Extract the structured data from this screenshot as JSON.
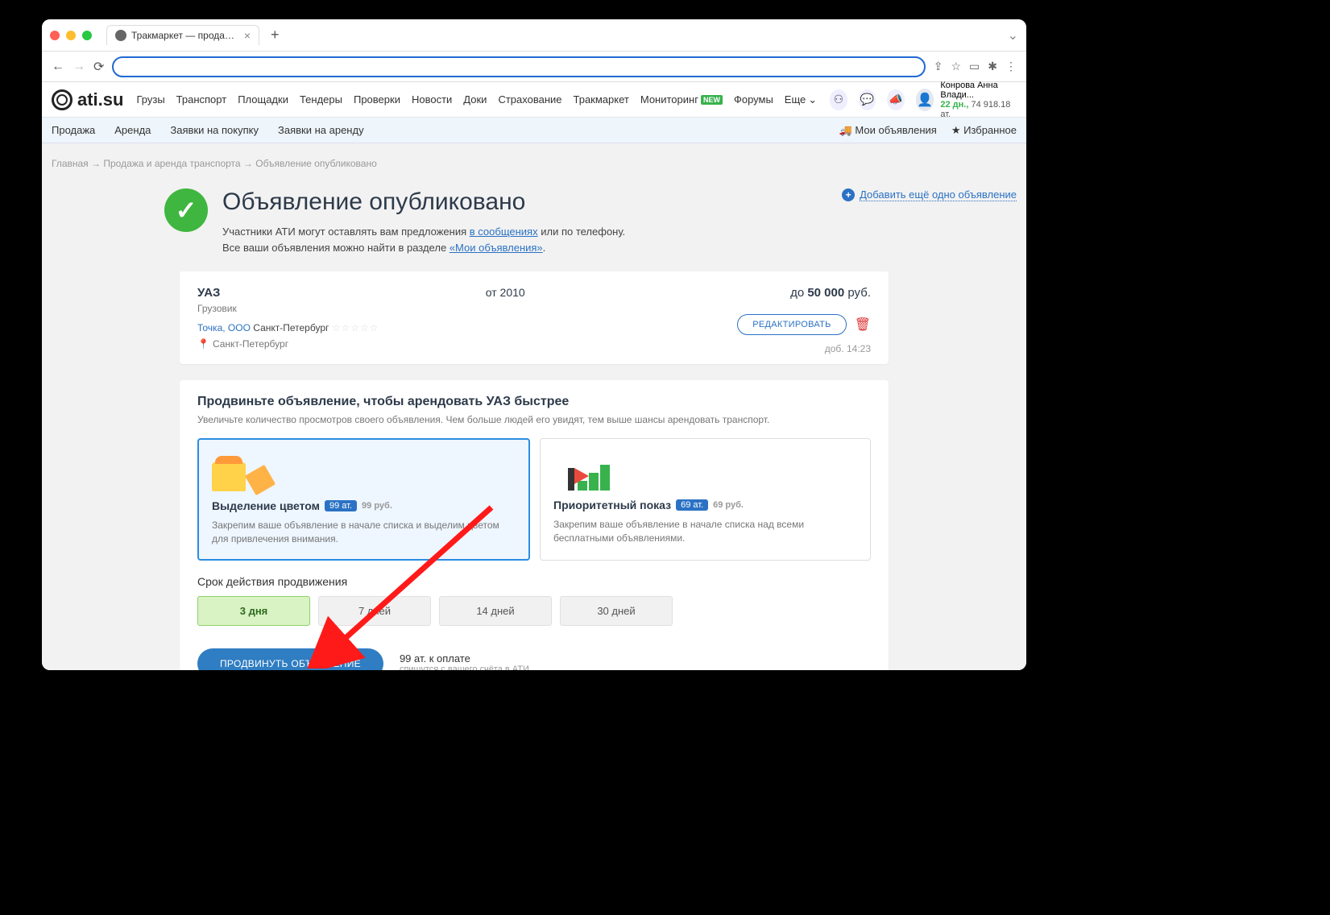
{
  "browser": {
    "tab_title": "Тракмаркет — продажа, арен"
  },
  "site": {
    "logo": "ati.su",
    "nav": [
      "Грузы",
      "Транспорт",
      "Площадки",
      "Тендеры",
      "Проверки",
      "Новости",
      "Доки",
      "Страхование",
      "Тракмаркет",
      "Мониторинг",
      "Форумы",
      "Еще"
    ],
    "nav_new_badge": "NEW",
    "user": {
      "name": "Конрова Анна Влади...",
      "days": "22 дн.,",
      "balance": "74 918.18 ат."
    }
  },
  "subnav": {
    "items": [
      "Продажа",
      "Аренда",
      "Заявки на покупку",
      "Заявки на аренду"
    ],
    "right": [
      {
        "icon": "truck",
        "label": "Мои объявления"
      },
      {
        "icon": "star",
        "label": "Избранное"
      }
    ]
  },
  "crumbs": [
    "Главная",
    "Продажа и аренда транспорта",
    "Объявление опубликовано"
  ],
  "hero": {
    "title": "Объявление опубликовано",
    "line1_a": "Участники АТИ могут оставлять вам предложения ",
    "line1_link": "в сообщениях",
    "line1_b": " или по телефону.",
    "line2_a": "Все ваши объявления можно найти в разделе ",
    "line2_link": "«Мои объявления»",
    "line2_b": ".",
    "add_more": "Добавить ещё одно объявление"
  },
  "listing": {
    "title": "УАЗ",
    "category": "Грузовик",
    "year": "от 2010",
    "price_prefix": "до ",
    "price_value": "50 000",
    "price_suffix": " руб.",
    "org": "Точка, ООО",
    "org_city": "Санкт-Петербург",
    "loc": "Санкт-Петербург",
    "edit": "РЕДАКТИРОВАТЬ",
    "timestamp": "доб. 14:23"
  },
  "promo": {
    "title": "Продвиньте объявление, чтобы арендовать УАЗ быстрее",
    "subtitle": "Увеличьте количество просмотров своего объявления. Чем больше людей его увидят, тем выше шансы арендовать транспорт.",
    "options": [
      {
        "title": "Выделение цветом",
        "price": "99 ат.",
        "rub": "99 руб.",
        "desc": "Закрепим ваше объявление в начале списка и выделим цветом для привлечения внимания.",
        "selected": true
      },
      {
        "title": "Приоритетный показ",
        "price": "69 ат.",
        "rub": "69 руб.",
        "desc": "Закрепим ваше объявление в начале списка над всеми бесплатными объявлениями.",
        "selected": false
      }
    ],
    "duration_label": "Срок действия продвижения",
    "durations": [
      "3 дня",
      "7 дней",
      "14 дней",
      "30 дней"
    ],
    "duration_selected": 0,
    "submit": "ПРОДВИНУТЬ ОБЪЯВЛЕНИЕ",
    "pay_amount": "99 ат. к оплате",
    "pay_note": "спишутся с вашего счёта в АТИ"
  }
}
